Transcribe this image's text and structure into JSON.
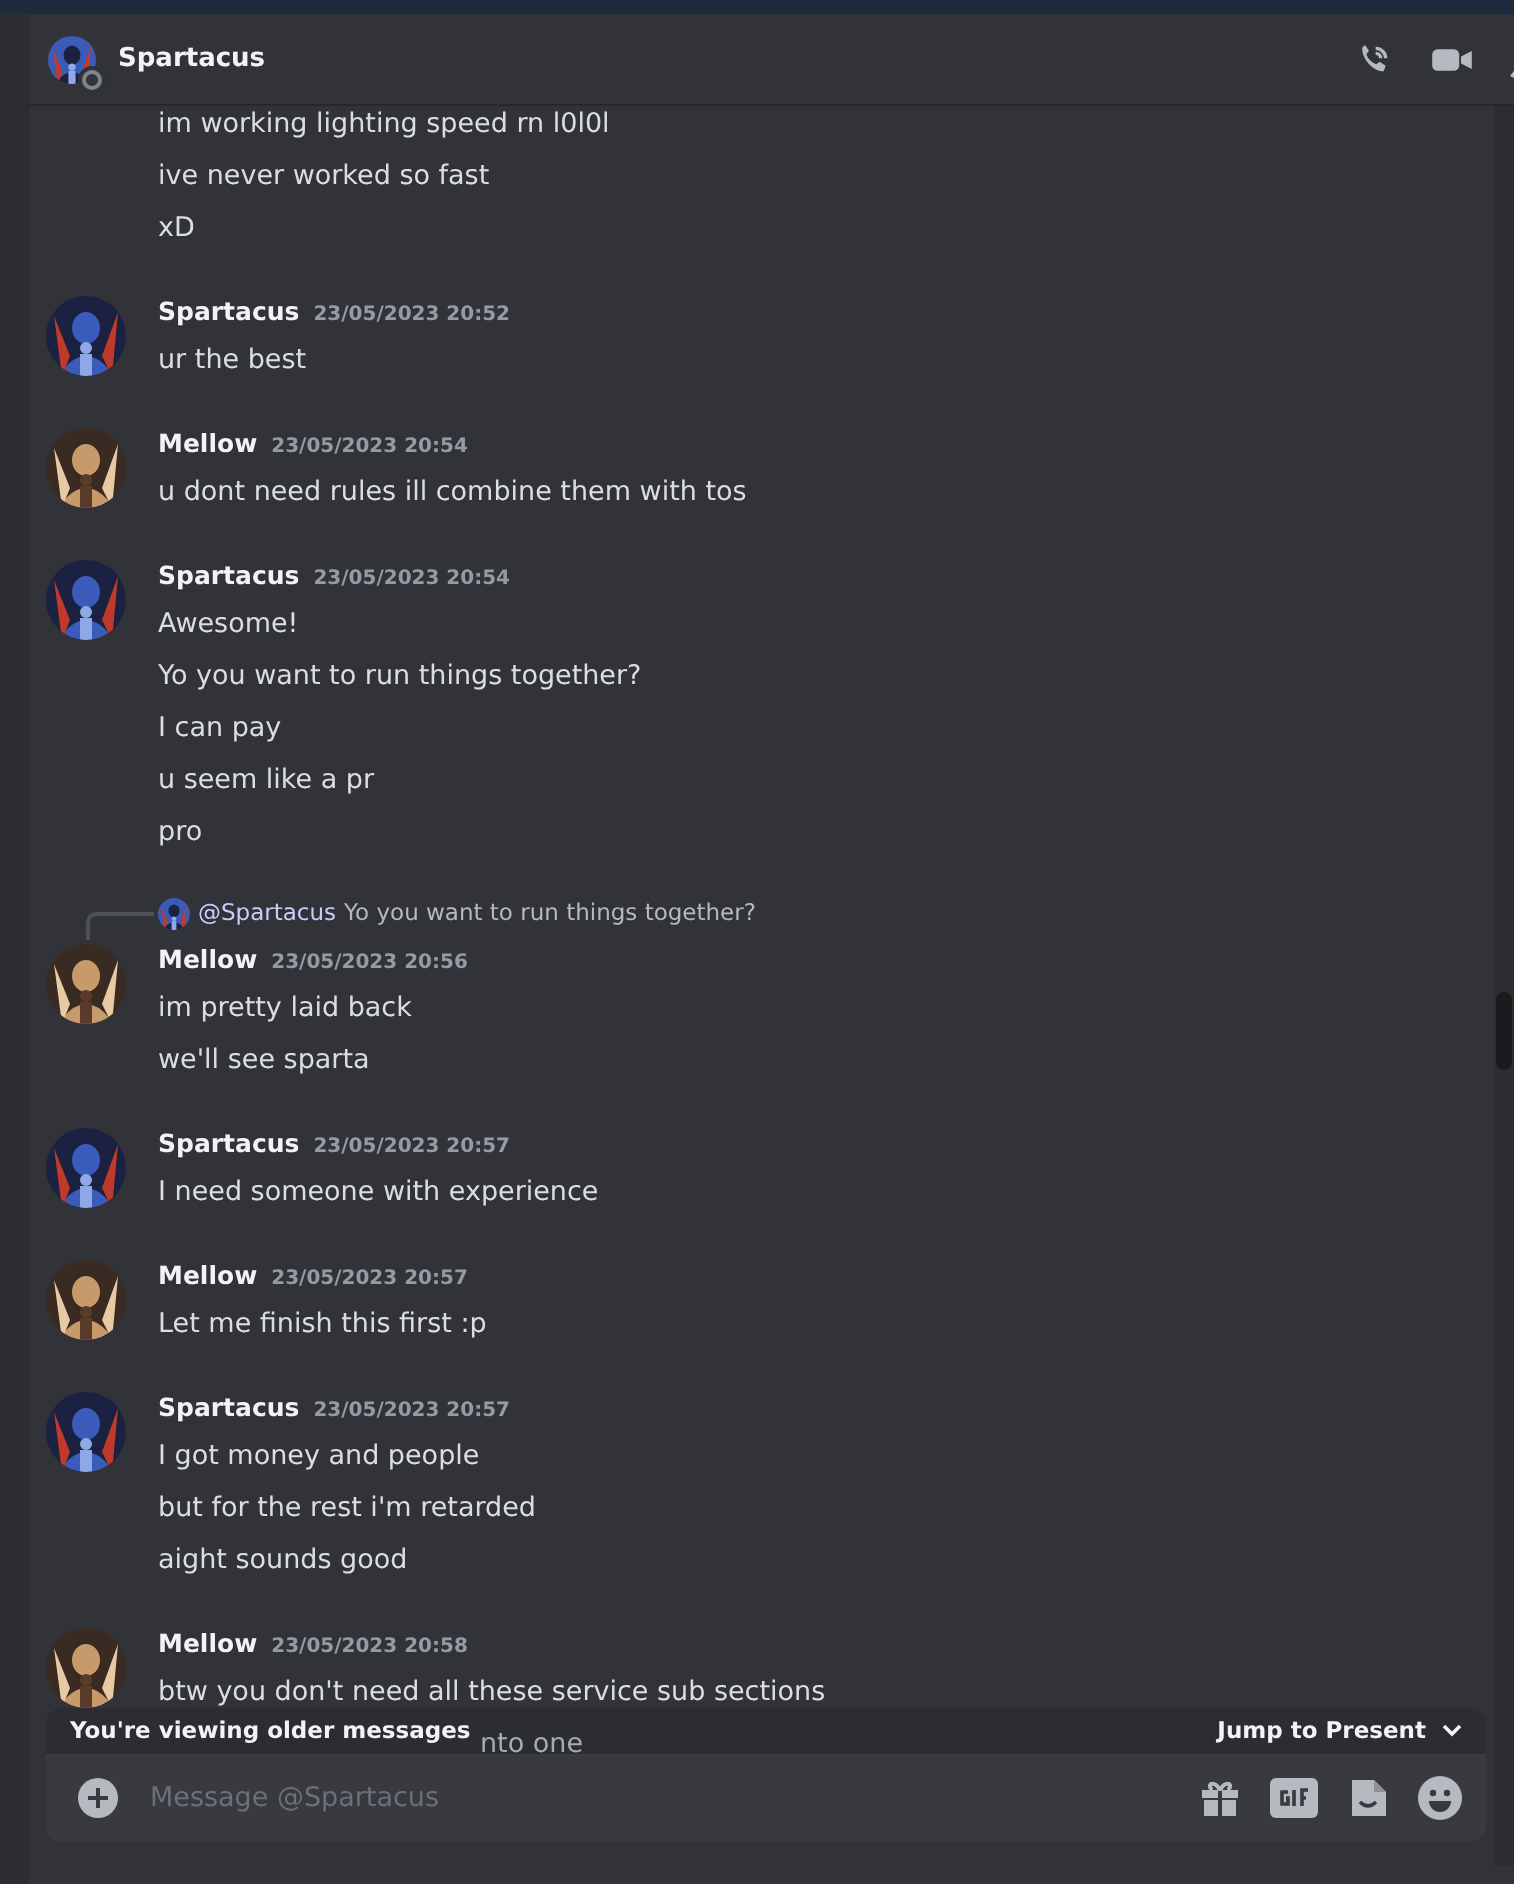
{
  "header": {
    "title": "Spartacus",
    "online": false,
    "color": "#3b5bb8"
  },
  "messages": [
    {
      "lines": [
        "im working lighting speed rn l0l0l",
        "ive never worked so fast",
        "xD"
      ]
    },
    {
      "author": "Spartacus",
      "color": "#3b5bb8",
      "timestamp": "23/05/2023 20:52",
      "lines": [
        "ur the best"
      ]
    },
    {
      "author": "Mellow",
      "color": "#c79a6c",
      "timestamp": "23/05/2023 20:54",
      "lines": [
        "u dont need rules ill combine them with tos"
      ]
    },
    {
      "author": "Spartacus",
      "color": "#3b5bb8",
      "timestamp": "23/05/2023 20:54",
      "lines": [
        "Awesome!",
        "Yo you want to run things together?",
        "I can pay",
        "u seem like a pr",
        "pro"
      ]
    },
    {
      "author": "Mellow",
      "color": "#c79a6c",
      "timestamp": "23/05/2023 20:56",
      "reply": {
        "color": "#3b5bb8",
        "mention": "@Spartacus",
        "text": "Yo you want to run things together?"
      },
      "lines": [
        "im pretty laid back",
        "we'll see sparta"
      ]
    },
    {
      "author": "Spartacus",
      "color": "#3b5bb8",
      "timestamp": "23/05/2023 20:57",
      "lines": [
        "I need someone with experience"
      ]
    },
    {
      "author": "Mellow",
      "color": "#c79a6c",
      "timestamp": "23/05/2023 20:57",
      "lines": [
        "Let me finish this first :p"
      ]
    },
    {
      "author": "Spartacus",
      "color": "#3b5bb8",
      "timestamp": "23/05/2023 20:57",
      "lines": [
        "I got money and people",
        "but for the rest i'm retarded",
        "aight sounds good"
      ]
    },
    {
      "author": "Mellow",
      "color": "#c79a6c",
      "timestamp": "23/05/2023 20:58",
      "lines": [
        "btw you don't need all these service sub sections"
      ],
      "covered_line": "nto one"
    }
  ],
  "banner": {
    "text": "You're viewing older messages",
    "action": "Jump to Present"
  },
  "composer": {
    "placeholder": "Message @Spartacus"
  }
}
